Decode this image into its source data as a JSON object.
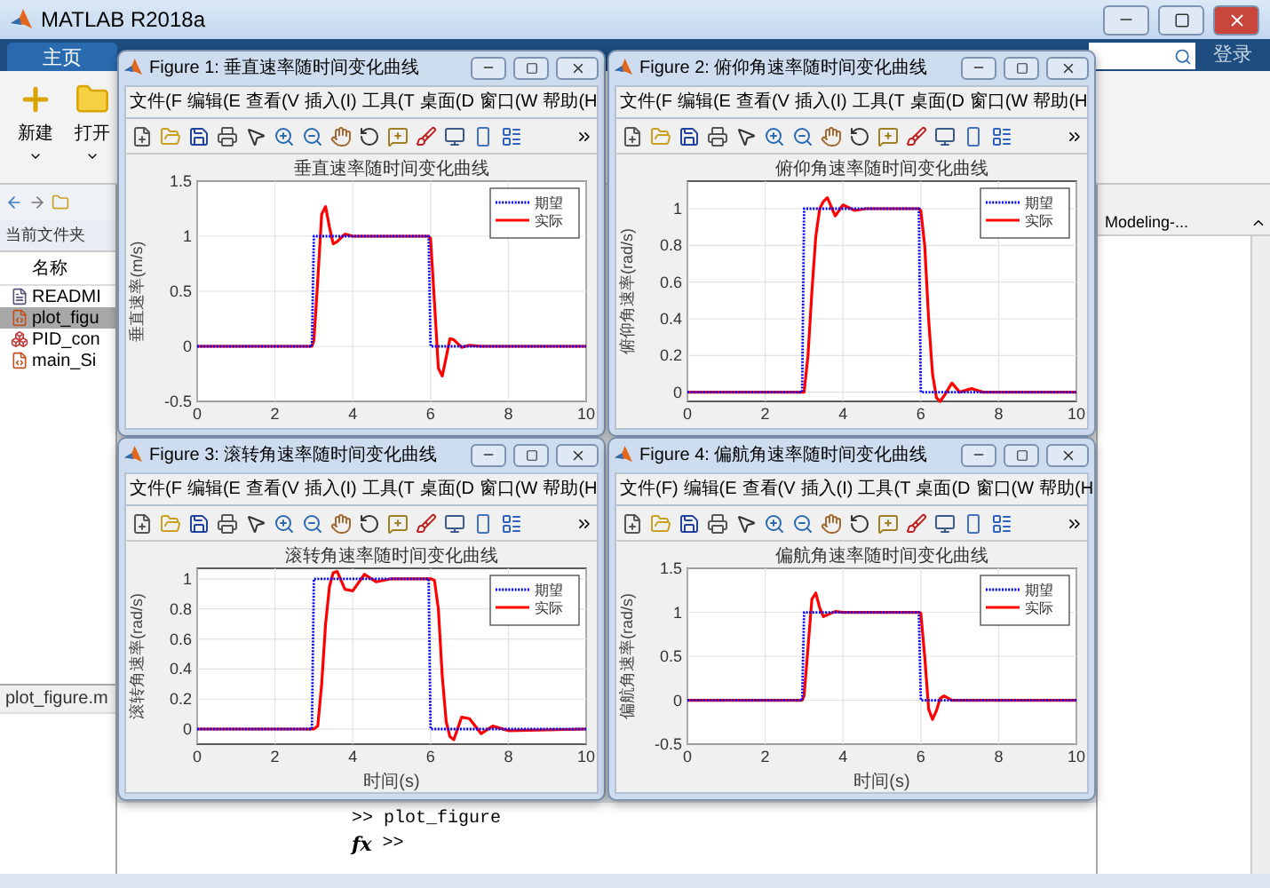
{
  "window": {
    "title": "MATLAB R2018a"
  },
  "ribbon": {
    "tabs": [
      {
        "label": "主页",
        "selected": true
      }
    ],
    "buttons": [
      {
        "label": "新建",
        "kind": "new"
      },
      {
        "label": "打开",
        "kind": "open"
      }
    ],
    "login": "登录"
  },
  "file_browser": {
    "title": "当前文件夹",
    "column": "名称",
    "files": [
      {
        "name": "READMI",
        "kind": "text",
        "selected": false
      },
      {
        "name": "plot_figu",
        "kind": "script",
        "selected": true
      },
      {
        "name": "PID_con",
        "kind": "model",
        "selected": false
      },
      {
        "name": "main_Si",
        "kind": "script",
        "selected": false
      }
    ],
    "details_title": "plot_figure.m"
  },
  "right_panel": {
    "label": "Modeling-..."
  },
  "command_window": {
    "lines": [
      ">> plot_figure"
    ],
    "prompt_icon": "fx",
    "prompt": ">>"
  },
  "figures": [
    {
      "title": "Figure 1: 垂直速率随时间变化曲线",
      "menu": [
        "文件(F",
        "编辑(E",
        "查看(V",
        "插入(I)",
        "工具(T",
        "桌面(D",
        "窗口(W",
        "帮助(H"
      ],
      "chart_data": {
        "type": "line",
        "title": "垂直速率随时间变化曲线",
        "ylabel": "垂直速率(m/s)",
        "grid": true,
        "legend": true,
        "x": [
          0,
          2.95,
          3,
          3.1,
          3.2,
          3.3,
          3.4,
          3.5,
          3.6,
          3.8,
          4,
          4.3,
          4.6,
          5,
          5.95,
          6,
          6.1,
          6.2,
          6.3,
          6.4,
          6.5,
          6.6,
          6.8,
          7,
          7.3,
          7.6,
          8,
          10
        ],
        "series": [
          {
            "name": "期望",
            "color": "#0000ff",
            "line_style": "dotted",
            "values": [
              0,
              0,
              1,
              1,
              1,
              1,
              1,
              1,
              1,
              1,
              1,
              1,
              1,
              1,
              1,
              0,
              0,
              0,
              0,
              0,
              0,
              0,
              0,
              0,
              0,
              0,
              0,
              0
            ]
          },
          {
            "name": "实际",
            "color": "#ff0000",
            "line_style": "solid",
            "values": [
              0,
              0,
              0.05,
              0.6,
              1.2,
              1.27,
              1.08,
              0.93,
              0.95,
              1.02,
              1,
              1,
              1,
              1,
              1,
              0.98,
              0.4,
              -0.2,
              -0.27,
              -0.1,
              0.07,
              0.06,
              -0.01,
              0.01,
              0,
              0,
              0,
              0
            ]
          }
        ],
        "xlim": [
          0,
          10
        ],
        "ylim": [
          -0.5,
          1.5
        ],
        "xticks": [
          0,
          2,
          4,
          6,
          8,
          10
        ],
        "yticks": [
          -0.5,
          0,
          0.5,
          1,
          1.5
        ]
      }
    },
    {
      "title": "Figure 2: 俯仰角速率随时间变化曲线",
      "menu": [
        "文件(F",
        "编辑(E",
        "查看(V",
        "插入(I)",
        "工具(T",
        "桌面(D",
        "窗口(W",
        "帮助(H"
      ],
      "chart_data": {
        "type": "line",
        "title": "俯仰角速率随时间变化曲线",
        "ylabel": "俯仰角速率(rad/s)",
        "grid": true,
        "legend": true,
        "x": [
          0,
          2.95,
          3,
          3.1,
          3.2,
          3.3,
          3.4,
          3.5,
          3.6,
          3.8,
          4,
          4.3,
          4.6,
          5,
          5.95,
          6,
          6.1,
          6.2,
          6.3,
          6.4,
          6.5,
          6.6,
          6.8,
          7,
          7.3,
          7.6,
          8,
          10
        ],
        "series": [
          {
            "name": "期望",
            "color": "#0000ff",
            "line_style": "dotted",
            "values": [
              0,
              0,
              1,
              1,
              1,
              1,
              1,
              1,
              1,
              1,
              1,
              1,
              1,
              1,
              1,
              0,
              0,
              0,
              0,
              0,
              0,
              0,
              0,
              0,
              0,
              0,
              0,
              0
            ]
          },
          {
            "name": "实际",
            "color": "#ff0000",
            "line_style": "solid",
            "values": [
              0,
              0,
              0,
              0.2,
              0.55,
              0.85,
              1,
              1.04,
              1.06,
              0.96,
              1.02,
              0.99,
              1,
              1,
              1,
              0.99,
              0.8,
              0.4,
              0.1,
              -0.03,
              -0.05,
              -0.02,
              0.05,
              0,
              0.02,
              0,
              0,
              0
            ]
          }
        ],
        "xlim": [
          0,
          10
        ],
        "ylim": [
          -0.05,
          1.15
        ],
        "xticks": [
          0,
          2,
          4,
          6,
          8,
          10
        ],
        "yticks": [
          0,
          0.2,
          0.4,
          0.6,
          0.8,
          1
        ]
      }
    },
    {
      "title": "Figure 3: 滚转角速率随时间变化曲线",
      "menu": [
        "文件(F",
        "编辑(E",
        "查看(V",
        "插入(I)",
        "工具(T",
        "桌面(D",
        "窗口(W",
        "帮助(H"
      ],
      "chart_data": {
        "type": "line",
        "title": "滚转角速率随时间变化曲线",
        "xlabel": "时间(s)",
        "ylabel": "滚转角速率(rad/s)",
        "grid": true,
        "legend": true,
        "x": [
          0,
          2.95,
          3,
          3.1,
          3.2,
          3.3,
          3.4,
          3.5,
          3.6,
          3.8,
          4,
          4.3,
          4.6,
          5,
          5.95,
          6,
          6.1,
          6.2,
          6.3,
          6.4,
          6.5,
          6.6,
          6.8,
          7,
          7.3,
          7.6,
          8,
          10
        ],
        "series": [
          {
            "name": "期望",
            "color": "#0000ff",
            "line_style": "dotted",
            "values": [
              0,
              0,
              1,
              1,
              1,
              1,
              1,
              1,
              1,
              1,
              1,
              1,
              1,
              1,
              1,
              0,
              0,
              0,
              0,
              0,
              0,
              0,
              0,
              0,
              0,
              0,
              0,
              0
            ]
          },
          {
            "name": "实际",
            "color": "#ff0000",
            "line_style": "solid",
            "values": [
              0,
              0,
              0,
              0.02,
              0.3,
              0.7,
              0.95,
              1.04,
              1.05,
              0.93,
              0.92,
              1.03,
              0.98,
              1,
              1,
              1,
              0.99,
              0.8,
              0.35,
              0.05,
              -0.05,
              -0.07,
              0.08,
              0.07,
              -0.03,
              0.02,
              -0.01,
              0
            ]
          }
        ],
        "xlim": [
          0,
          10
        ],
        "ylim": [
          -0.1,
          1.07
        ],
        "xticks": [
          0,
          2,
          4,
          6,
          8,
          10
        ],
        "yticks": [
          0,
          0.2,
          0.4,
          0.6,
          0.8,
          1
        ]
      }
    },
    {
      "title": "Figure 4: 偏航角速率随时间变化曲线",
      "menu": [
        "文件(F)",
        "编辑(E",
        "查看(V",
        "插入(I)",
        "工具(T",
        "桌面(D",
        "窗口(W",
        "帮助(H"
      ],
      "chart_data": {
        "type": "line",
        "title": "偏航角速率随时间变化曲线",
        "xlabel": "时间(s)",
        "ylabel": "偏航角速率(rad/s)",
        "grid": true,
        "legend": true,
        "x": [
          0,
          2.95,
          3,
          3.1,
          3.2,
          3.3,
          3.4,
          3.5,
          3.6,
          3.8,
          4,
          4.3,
          4.6,
          5,
          5.95,
          6,
          6.1,
          6.2,
          6.3,
          6.4,
          6.5,
          6.6,
          6.8,
          7,
          7.3,
          7.6,
          8,
          10
        ],
        "series": [
          {
            "name": "期望",
            "color": "#0000ff",
            "line_style": "dotted",
            "values": [
              0,
              0,
              1,
              1,
              1,
              1,
              1,
              1,
              1,
              1,
              1,
              1,
              1,
              1,
              1,
              0,
              0,
              0,
              0,
              0,
              0,
              0,
              0,
              0,
              0,
              0,
              0,
              0
            ]
          },
          {
            "name": "实际",
            "color": "#ff0000",
            "line_style": "solid",
            "values": [
              0,
              0,
              0.05,
              0.6,
              1.15,
              1.22,
              1.05,
              0.95,
              0.97,
              1.01,
              1,
              1,
              1,
              1,
              1,
              0.99,
              0.5,
              -0.1,
              -0.22,
              -0.12,
              0.02,
              0.05,
              0,
              0,
              0,
              0,
              0,
              0
            ]
          }
        ],
        "xlim": [
          0,
          10
        ],
        "ylim": [
          -0.5,
          1.5
        ],
        "xticks": [
          0,
          2,
          4,
          6,
          8,
          10
        ],
        "yticks": [
          -0.5,
          0,
          0.5,
          1,
          1.5
        ]
      }
    }
  ]
}
